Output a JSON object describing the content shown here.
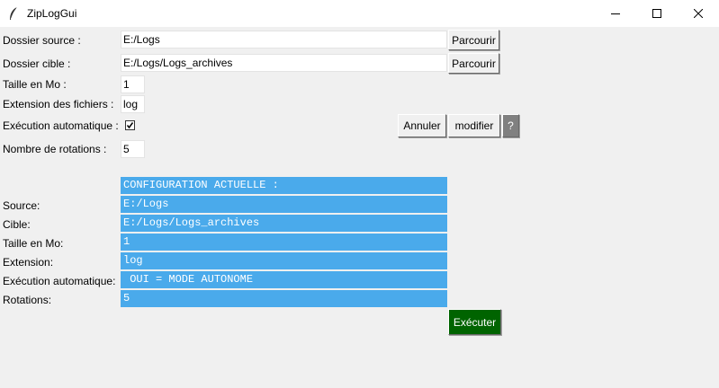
{
  "window": {
    "title": "ZipLogGui"
  },
  "form": {
    "source_label": "Dossier source :",
    "source_value": "E:/Logs",
    "target_label": "Dossier cible :",
    "target_value": "E:/Logs/Logs_archives",
    "browse_label": "Parcourir",
    "size_label": "Taille en Mo :",
    "size_value": "1",
    "ext_label": "Extension des fichiers :",
    "ext_value": "log",
    "auto_label": "Exécution automatique :",
    "auto_checked": true,
    "rotations_label": "Nombre de rotations :",
    "rotations_value": "5",
    "cancel_label": "Annuler",
    "modify_label": "modifier",
    "help_label": "?"
  },
  "config": {
    "header": "CONFIGURATION ACTUELLE :",
    "rows": [
      {
        "label": "Source:",
        "value": "E:/Logs"
      },
      {
        "label": "Cible:",
        "value": "E:/Logs/Logs_archives"
      },
      {
        "label": "Taille en Mo:",
        "value": "1"
      },
      {
        "label": "Extension:",
        "value": "log"
      },
      {
        "label": "Exécution automatique:",
        "value": " OUI = MODE AUTONOME"
      },
      {
        "label": "Rotations:",
        "value": "5"
      }
    ]
  },
  "execute_label": "Exécuter",
  "colors": {
    "config_bg": "#4aaaeb",
    "execute_bg": "#006400",
    "help_bg": "#808080"
  }
}
